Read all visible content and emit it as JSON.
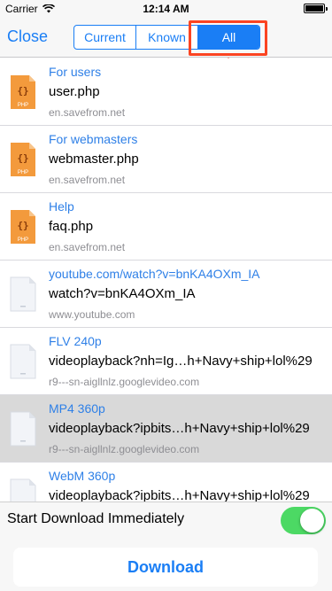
{
  "status_bar": {
    "carrier": "Carrier",
    "time": "12:14 AM"
  },
  "nav": {
    "close_label": "Close",
    "segments": [
      "Current",
      "Known",
      "All"
    ],
    "active_segment": "All"
  },
  "items": [
    {
      "title": "For users",
      "name": "user.php",
      "host": "en.savefrom.net",
      "icon": "php-file-icon"
    },
    {
      "title": "For webmasters",
      "name": "webmaster.php",
      "host": "en.savefrom.net",
      "icon": "php-file-icon"
    },
    {
      "title": "Help",
      "name": "faq.php",
      "host": "en.savefrom.net",
      "icon": "php-file-icon"
    },
    {
      "title": "youtube.com/watch?v=bnKA4OXm_IA",
      "name": "watch?v=bnKA4OXm_IA",
      "host": "www.youtube.com",
      "icon": "blank-file-icon"
    },
    {
      "title": "FLV 240p",
      "name": "videoplayback?nh=Ig…h+Navy+ship+lol%29",
      "host": "r9---sn-aigllnlz.googlevideo.com",
      "icon": "blank-file-icon"
    },
    {
      "title": "MP4 360p",
      "name": "videoplayback?ipbits…h+Navy+ship+lol%29",
      "host": "r9---sn-aigllnlz.googlevideo.com",
      "icon": "blank-file-icon",
      "selected": true
    },
    {
      "title": "WebM 360p",
      "name": "videoplayback?ipbits…h+Navy+ship+lol%29",
      "host": "",
      "icon": "blank-file-icon"
    }
  ],
  "footer": {
    "toggle_label": "Start Download Immediately",
    "toggle_on": true,
    "download_label": "Download"
  },
  "colors": {
    "accent": "#1a7ef5",
    "highlight": "#fb4422",
    "toggle_on": "#4cd964"
  }
}
